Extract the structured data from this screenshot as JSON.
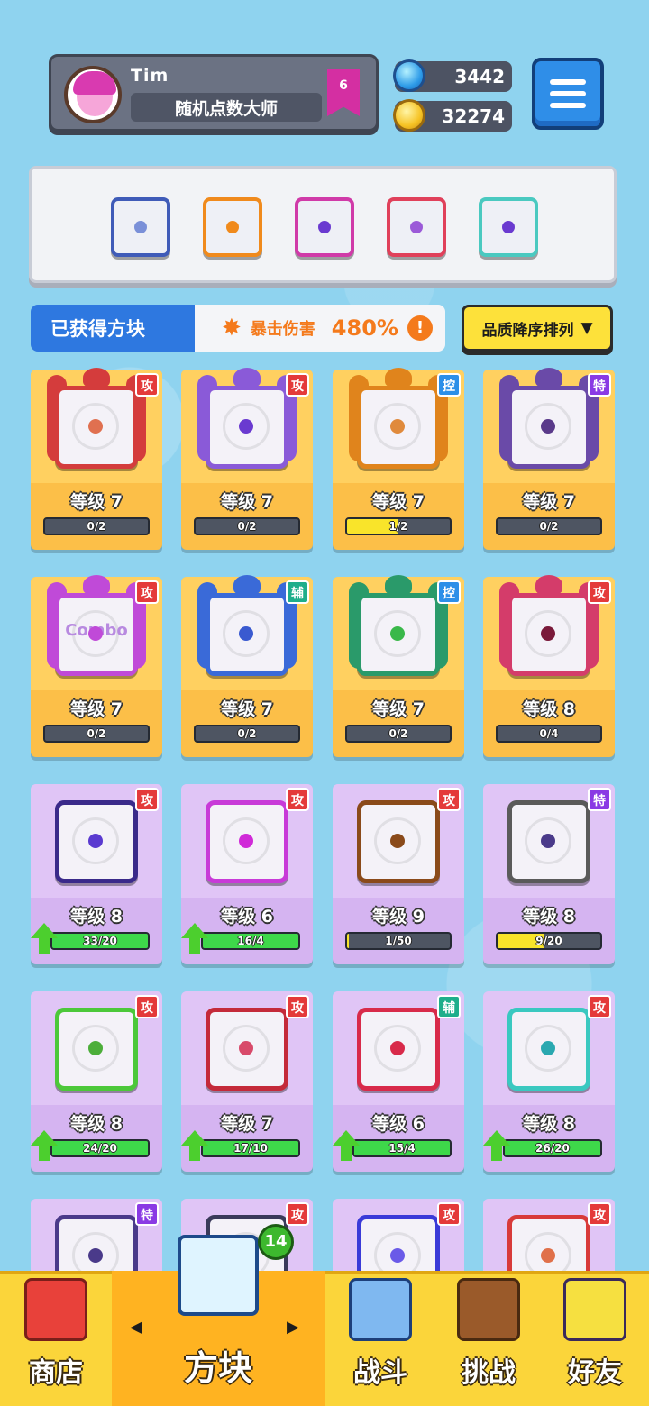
{
  "player": {
    "name": "Tim",
    "title": "随机点数大师",
    "rank": "6"
  },
  "currency": {
    "gems": "3442",
    "coins": "32274"
  },
  "loadout": [
    {
      "icon": "gear-dice-icon",
      "border": "#3f5bb8",
      "dot": "#7a90d8"
    },
    {
      "icon": "target-dice-icon",
      "border": "#f08a1c",
      "dot": "#f08a1c"
    },
    {
      "icon": "arrows-dice-icon",
      "border": "#d03aa8",
      "dot": "#6a3ad0"
    },
    {
      "icon": "rainbow-dice-icon",
      "border": "#e0405a",
      "dot": "#9b5ad8"
    },
    {
      "icon": "hands-dice-icon",
      "border": "#4ac9c0",
      "dot": "#6a3ad0"
    }
  ],
  "info": {
    "owned_label": "已获得方块",
    "crit_label": "暴击伤害",
    "crit_value": "480%",
    "info_symbol": "!",
    "sort_label": "品质降序排列",
    "sort_arrow": "▼"
  },
  "blocks": [
    {
      "tag": "攻",
      "tagType": "atk",
      "level": "等级 7",
      "progress": "0/2",
      "fill": 0,
      "color": "#d43c3c",
      "dot": "#e07050",
      "rarity": "gold",
      "ready": false,
      "checked": false
    },
    {
      "tag": "攻",
      "tagType": "atk",
      "level": "等级 7",
      "progress": "0/2",
      "fill": 0,
      "color": "#8a5ad8",
      "dot": "#6a3ad0",
      "rarity": "gold",
      "ready": false,
      "checked": false
    },
    {
      "tag": "控",
      "tagType": "ctl",
      "level": "等级 7",
      "progress": "1/2",
      "fill": 0.5,
      "color": "#e0841c",
      "dot": "#e08a3c",
      "rarity": "gold",
      "ready": false,
      "checked": false
    },
    {
      "tag": "特",
      "tagType": "spc",
      "level": "等级 7",
      "progress": "0/2",
      "fill": 0,
      "color": "#6a4aa8",
      "dot": "#5a3a8a",
      "rarity": "gold",
      "ready": false,
      "checked": false
    },
    {
      "tag": "攻",
      "tagType": "atk",
      "level": "等级 7",
      "progress": "0/2",
      "fill": 0,
      "color": "#c04ad8",
      "dot": "#c04ad8",
      "rarity": "gold",
      "ready": false,
      "checked": false,
      "art_text": "Combo"
    },
    {
      "tag": "辅",
      "tagType": "sup",
      "level": "等级 7",
      "progress": "0/2",
      "fill": 0,
      "color": "#3a6ad8",
      "dot": "#3a5ad0",
      "rarity": "gold",
      "ready": false,
      "checked": false
    },
    {
      "tag": "控",
      "tagType": "ctl",
      "level": "等级 7",
      "progress": "0/2",
      "fill": 0,
      "color": "#2a9a6a",
      "dot": "#3ab84a",
      "rarity": "gold",
      "ready": false,
      "checked": false
    },
    {
      "tag": "攻",
      "tagType": "atk",
      "level": "等级 8",
      "progress": "0/4",
      "fill": 0,
      "color": "#d43c6a",
      "dot": "#7a1a3a",
      "rarity": "gold",
      "ready": false,
      "checked": false
    },
    {
      "tag": "攻",
      "tagType": "atk",
      "level": "等级 8",
      "progress": "33/20",
      "fill": 1,
      "color": "#3a2a8a",
      "dot": "#5a3ad0",
      "rarity": "purple",
      "ready": true,
      "checked": false
    },
    {
      "tag": "攻",
      "tagType": "atk",
      "level": "等级 6",
      "progress": "16/4",
      "fill": 1,
      "color": "#c83ad8",
      "dot": "#d02ad8",
      "rarity": "purple",
      "ready": true,
      "checked": false
    },
    {
      "tag": "攻",
      "tagType": "atk",
      "level": "等级 9",
      "progress": "1/50",
      "fill": 0.02,
      "color": "#8a4a1a",
      "dot": "#8a4a1a",
      "rarity": "purple",
      "ready": false,
      "checked": true
    },
    {
      "tag": "特",
      "tagType": "spc",
      "level": "等级 8",
      "progress": "9/20",
      "fill": 0.45,
      "color": "#5a5a5a",
      "dot": "#4a3a8a",
      "rarity": "purple",
      "ready": false,
      "checked": true
    },
    {
      "tag": "攻",
      "tagType": "atk",
      "level": "等级 8",
      "progress": "24/20",
      "fill": 1,
      "color": "#4cc83a",
      "dot": "#4cae3a",
      "rarity": "purple",
      "ready": true,
      "checked": false
    },
    {
      "tag": "攻",
      "tagType": "atk",
      "level": "等级 7",
      "progress": "17/10",
      "fill": 1,
      "color": "#c42a3a",
      "dot": "#d84a6a",
      "rarity": "purple",
      "ready": true,
      "checked": false
    },
    {
      "tag": "辅",
      "tagType": "sup",
      "level": "等级 6",
      "progress": "15/4",
      "fill": 1,
      "color": "#d82a4a",
      "dot": "#d82a4a",
      "rarity": "purple",
      "ready": true,
      "checked": false
    },
    {
      "tag": "攻",
      "tagType": "atk",
      "level": "等级 8",
      "progress": "26/20",
      "fill": 1,
      "color": "#3ac8c0",
      "dot": "#2aa8b0",
      "rarity": "purple",
      "ready": true,
      "checked": false
    },
    {
      "tag": "特",
      "tagType": "spc",
      "level": "",
      "progress": "",
      "fill": 0,
      "color": "#4a3a8a",
      "dot": "#4a3a8a",
      "rarity": "purple",
      "ready": false,
      "checked": false
    },
    {
      "tag": "攻",
      "tagType": "atk",
      "level": "",
      "progress": "",
      "fill": 0,
      "color": "#3a3a5a",
      "dot": "#3a3a5a",
      "rarity": "purple",
      "ready": false,
      "checked": false
    },
    {
      "tag": "攻",
      "tagType": "atk",
      "level": "",
      "progress": "",
      "fill": 0,
      "color": "#3a3ad8",
      "dot": "#6a5ae8",
      "rarity": "purple",
      "ready": false,
      "checked": false
    },
    {
      "tag": "攻",
      "tagType": "atk",
      "level": "",
      "progress": "",
      "fill": 0,
      "color": "#d83a3a",
      "dot": "#e0704a",
      "rarity": "purple",
      "ready": false,
      "checked": false
    }
  ],
  "nav": {
    "shop": "商店",
    "blocks": "方块",
    "battle": "战斗",
    "challenge": "挑战",
    "friends": "好友",
    "blocks_badge": "14",
    "prev": "◀",
    "next": "▶"
  }
}
